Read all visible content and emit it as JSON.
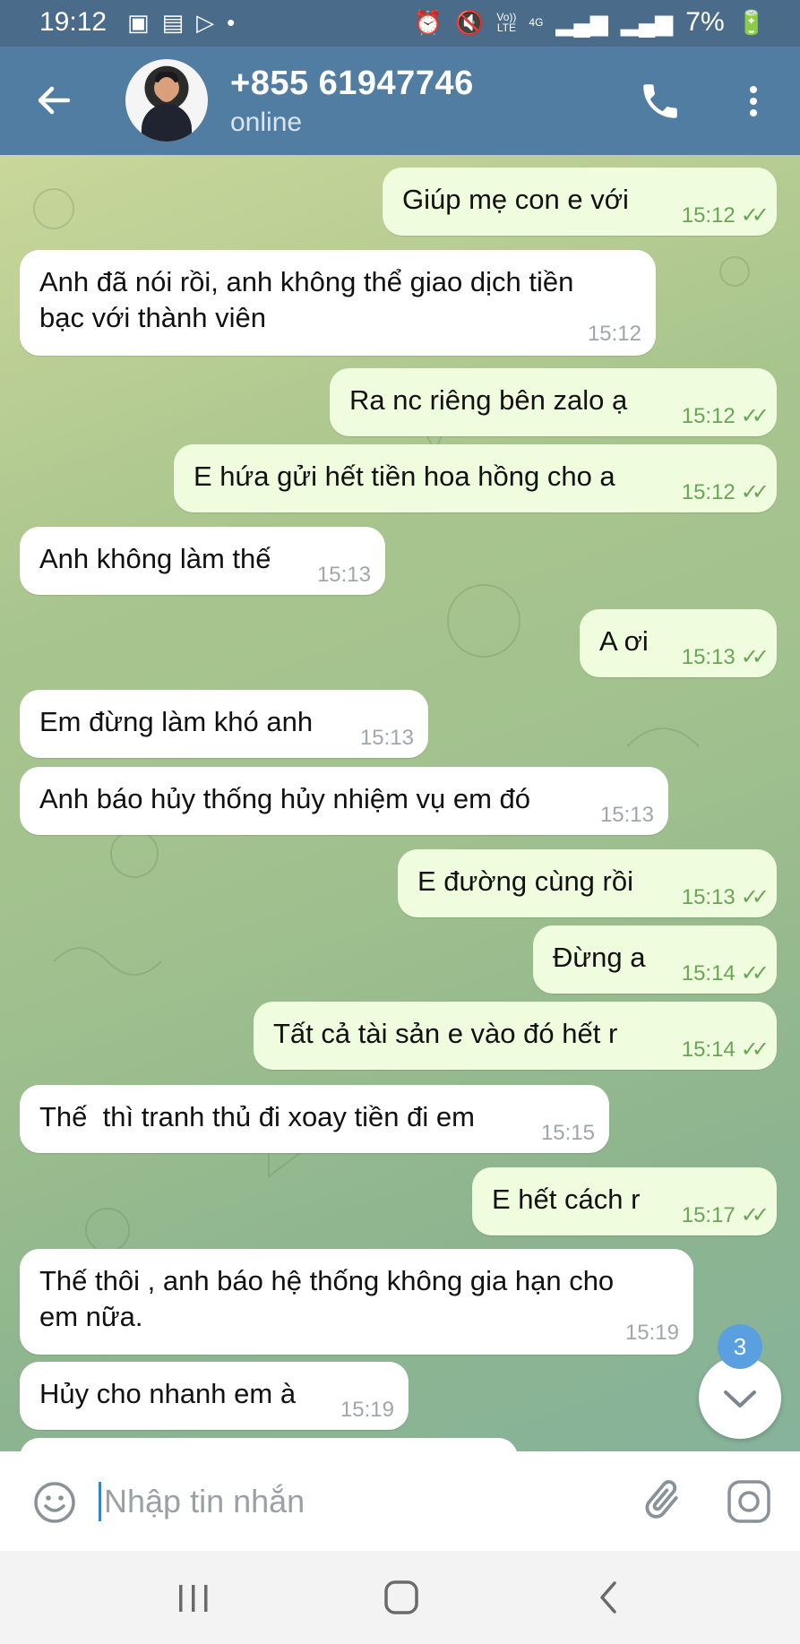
{
  "status_bar": {
    "time": "19:12",
    "left_icons": [
      "image-icon",
      "news-app-icon",
      "play-store-icon",
      "dot-icon"
    ],
    "vol_label": "Vo))",
    "lte_label": "LTE",
    "net_label": "4G",
    "battery": "7%"
  },
  "header": {
    "contact_name": "+855 61947746",
    "contact_status": "online"
  },
  "messages": [
    {
      "dir": "out",
      "text": "Giúp mẹ con e với",
      "time": "15:12",
      "ticks": "✓✓"
    },
    {
      "dir": "in",
      "text": "Anh đã nói rồi, anh không thể giao dịch tiền\nbạc với thành viên",
      "time": "15:12"
    },
    {
      "dir": "out",
      "text": "Ra nc riêng bên zalo ạ",
      "time": "15:12",
      "ticks": "✓✓"
    },
    {
      "dir": "out",
      "text": "E hứa gửi hết tiền hoa hồng cho a",
      "time": "15:12",
      "ticks": "✓✓"
    },
    {
      "dir": "in",
      "text": "Anh không làm thế",
      "time": "15:13"
    },
    {
      "dir": "out",
      "text": "A ơi",
      "time": "15:13",
      "ticks": "✓✓"
    },
    {
      "dir": "in",
      "text": "Em đừng làm khó anh",
      "time": "15:13"
    },
    {
      "dir": "in",
      "text": "Anh báo hủy thống hủy nhiệm vụ em đó",
      "time": "15:13"
    },
    {
      "dir": "out",
      "text": "E đường cùng rồi",
      "time": "15:13",
      "ticks": "✓✓"
    },
    {
      "dir": "out",
      "text": "Đừng a",
      "time": "15:14",
      "ticks": "✓✓"
    },
    {
      "dir": "out",
      "text": "Tất cả tài sản e vào đó hết r",
      "time": "15:14",
      "ticks": "✓✓"
    },
    {
      "dir": "in",
      "text": "Thế  thì tranh thủ đi xoay tiền đi em",
      "time": "15:15"
    },
    {
      "dir": "out",
      "text": "E hết cách r",
      "time": "15:17",
      "ticks": "✓✓"
    },
    {
      "dir": "in",
      "text": "Thế thôi , anh báo hệ thống không gia hạn cho\nem nữa.",
      "time": "15:19"
    },
    {
      "dir": "in",
      "text": "Hủy cho nhanh em à",
      "time": "15:19"
    }
  ],
  "unread_count": "3",
  "input": {
    "placeholder": "Nhập tin nhắn"
  },
  "colors": {
    "header": "#517da2",
    "status_bar": "#4a6b8a",
    "outgoing_bubble": "#effdde",
    "incoming_bubble": "#ffffff",
    "accent": "#5aa0e0"
  }
}
